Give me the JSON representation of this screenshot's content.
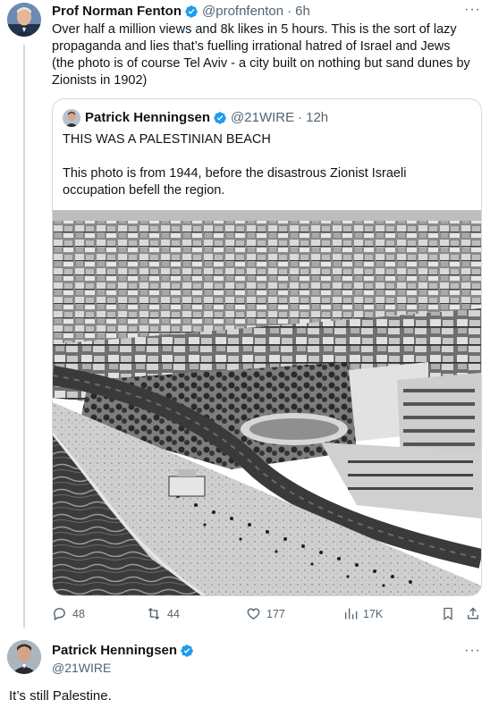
{
  "main_tweet": {
    "name": "Prof Norman Fenton",
    "handle": "@profnfenton",
    "separator": "·",
    "time": "6h",
    "more": "···",
    "text": "Over half a million views and 8k likes in 5 hours. This is the sort of lazy propaganda and lies that’s fuelling irrational hatred of Israel and Jews (the photo is of course Tel Aviv - a city built on nothing but sand dunes by Zionists in 1902)"
  },
  "quoted_tweet": {
    "name": "Patrick Henningsen",
    "handle": "@21WIRE",
    "separator": "·",
    "time": "12h",
    "text": "THIS WAS A PALESTINIAN BEACH\n\nThis  photo is from 1944, before the disastrous Zionist Israeli occupation befell the region.",
    "image_icon": "aerial-beach-city-photo"
  },
  "actions": {
    "reply_count": "48",
    "retweet_count": "44",
    "like_count": "177",
    "views_count": "17K"
  },
  "reply_tweet": {
    "name": "Patrick Henningsen",
    "handle": "@21WIRE",
    "more": "···",
    "text": "It’s still Palestine."
  },
  "colors": {
    "verified": "#1d9bf0",
    "muted": "#536471",
    "border": "#cfd9de"
  }
}
